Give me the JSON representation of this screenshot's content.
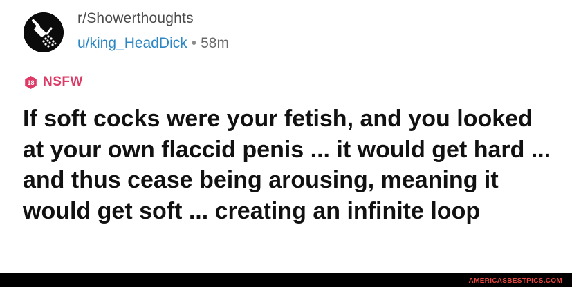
{
  "header": {
    "subreddit": "r/Showerthoughts",
    "username": "u/king_HeadDick",
    "separator": "•",
    "age": "58m",
    "avatar_icon": "showerhead-icon"
  },
  "tag": {
    "icon": "nsfw-18-icon",
    "icon_text": "18",
    "label": "NSFW",
    "color": "#dd3a66"
  },
  "post": {
    "title": "If soft cocks were your fetish, and you looked at your own flaccid penis ... it would get hard ... and thus cease being arousing, meaning it would get soft ... creating an infinite loop"
  },
  "footer": {
    "watermark": "AMERICASBESTPICS.COM"
  },
  "colors": {
    "username": "#2a86c5",
    "subreddit": "#4a4a4a",
    "title": "#111111",
    "watermark": "#e8473f"
  }
}
